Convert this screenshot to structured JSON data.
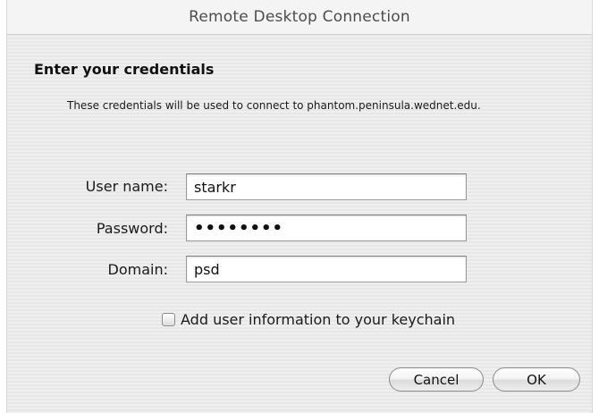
{
  "window": {
    "title": "Remote Desktop Connection"
  },
  "dialog": {
    "heading": "Enter your credentials",
    "description": "These credentials will be used to connect to phantom.peninsula.wednet.edu."
  },
  "fields": {
    "username": {
      "label": "User name:",
      "value": "starkr"
    },
    "password": {
      "label": "Password:",
      "value": "••••••••"
    },
    "domain": {
      "label": "Domain:",
      "value": "psd"
    }
  },
  "keychain": {
    "label": "Add user information to your keychain",
    "checked": false
  },
  "buttons": {
    "cancel": "Cancel",
    "ok": "OK"
  }
}
